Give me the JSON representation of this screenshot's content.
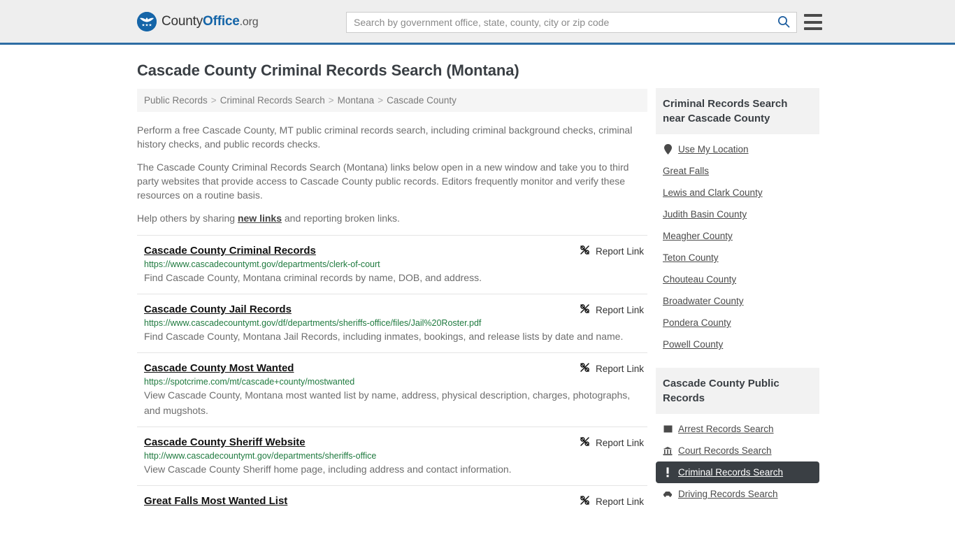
{
  "header": {
    "logo_text_1": "County",
    "logo_text_2": "Office",
    "logo_text_3": ".org",
    "logo_icon": "eagle-shield-icon",
    "search_placeholder": "Search by government office, state, county, city or zip code",
    "search_value": "",
    "search_icon": "search-icon",
    "menu_icon": "hamburger-menu-icon",
    "accent_color": "#2e6da4",
    "background_color": "#eeeeee"
  },
  "page": {
    "title": "Cascade County Criminal Records Search (Montana)"
  },
  "breadcrumb": {
    "separator": ">",
    "items": [
      {
        "label": "Public Records"
      },
      {
        "label": "Criminal Records Search"
      },
      {
        "label": "Montana"
      },
      {
        "label": "Cascade County"
      }
    ]
  },
  "intro": {
    "paragraph_1": "Perform a free Cascade County, MT public criminal records search, including criminal background checks, criminal history checks, and public records checks.",
    "paragraph_2": "The Cascade County Criminal Records Search (Montana) links below open in a new window and take you to third party websites that provide access to Cascade County public records. Editors frequently monitor and verify these resources on a routine basis.",
    "paragraph_3_before": "Help others by sharing ",
    "paragraph_3_link": "new links",
    "paragraph_3_after": " and reporting broken links."
  },
  "results": {
    "report_label": "Report Link",
    "report_icon": "broken-link-icon",
    "url_color": "#1f7a3f",
    "items": [
      {
        "title": "Cascade County Criminal Records",
        "url": "https://www.cascadecountymt.gov/departments/clerk-of-court",
        "description": "Find Cascade County, Montana criminal records by name, DOB, and address."
      },
      {
        "title": "Cascade County Jail Records",
        "url": "https://www.cascadecountymt.gov/df/departments/sheriffs-office/files/Jail%20Roster.pdf",
        "description": "Find Cascade County, Montana Jail Records, including inmates, bookings, and release lists by date and name."
      },
      {
        "title": "Cascade County Most Wanted",
        "url": "https://spotcrime.com/mt/cascade+county/mostwanted",
        "description": "View Cascade County, Montana most wanted list by name, address, physical description, charges, photographs, and mugshots."
      },
      {
        "title": "Cascade County Sheriff Website",
        "url": "http://www.cascadecountymt.gov/departments/sheriffs-office",
        "description": "View Cascade County Sheriff home page, including address and contact information."
      },
      {
        "title": "Great Falls Most Wanted List",
        "url": "",
        "description": ""
      }
    ]
  },
  "sidebar": {
    "nearby_panel": {
      "heading": "Criminal Records Search near Cascade County",
      "items": [
        {
          "label": "Use My Location",
          "icon": "map-pin-icon"
        },
        {
          "label": "Great Falls",
          "icon": ""
        },
        {
          "label": "Lewis and Clark County",
          "icon": ""
        },
        {
          "label": "Judith Basin County",
          "icon": ""
        },
        {
          "label": "Meagher County",
          "icon": ""
        },
        {
          "label": "Teton County",
          "icon": ""
        },
        {
          "label": "Chouteau County",
          "icon": ""
        },
        {
          "label": "Broadwater County",
          "icon": ""
        },
        {
          "label": "Pondera County",
          "icon": ""
        },
        {
          "label": "Powell County",
          "icon": ""
        }
      ]
    },
    "records_panel": {
      "heading": "Cascade County Public Records",
      "active_color": "#3a3f44",
      "items": [
        {
          "label": "Arrest Records Search",
          "icon": "fingerprint-card-icon",
          "active": false
        },
        {
          "label": "Court Records Search",
          "icon": "courthouse-icon",
          "active": false
        },
        {
          "label": "Criminal Records Search",
          "icon": "exclamation-icon",
          "active": true
        },
        {
          "label": "Driving Records Search",
          "icon": "car-icon",
          "active": false
        }
      ]
    }
  }
}
